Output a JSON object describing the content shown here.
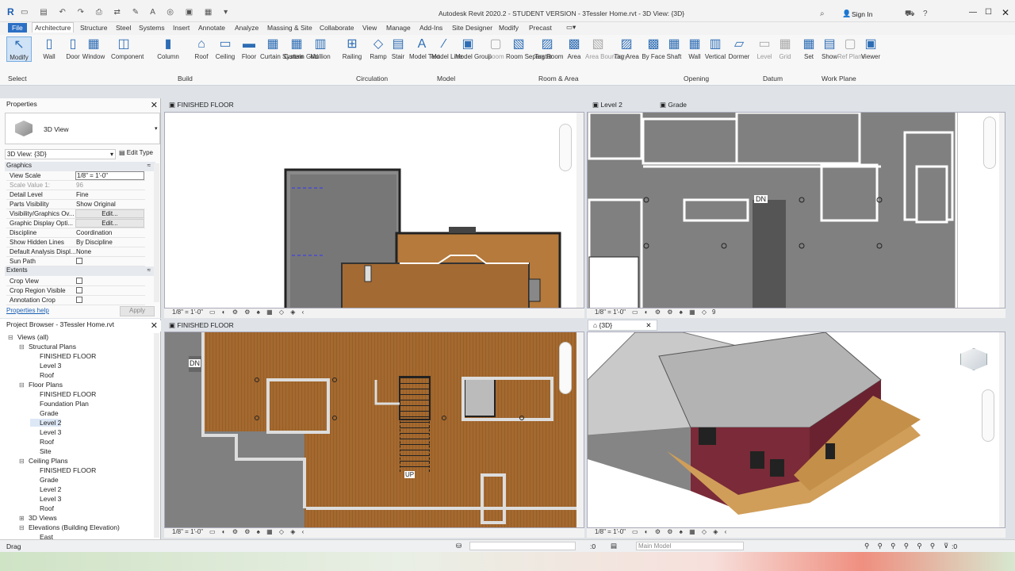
{
  "window": {
    "title": "Autodesk Revit 2020.2 - STUDENT VERSION - 3Tessler Home.rvt - 3D View: {3D}",
    "sign_in": "Sign In"
  },
  "tabs": [
    "File",
    "Architecture",
    "Structure",
    "Steel",
    "Systems",
    "Insert",
    "Annotate",
    "Analyze",
    "Massing & Site",
    "Collaborate",
    "View",
    "Manage",
    "Add-Ins",
    "Site Designer",
    "Modify",
    "Precast"
  ],
  "ribbon": {
    "buttons": [
      {
        "label": "Modify"
      },
      {
        "label": "Wall"
      },
      {
        "label": "Door"
      },
      {
        "label": "Window"
      },
      {
        "label": "Component"
      },
      {
        "label": "Column"
      },
      {
        "label": "Roof"
      },
      {
        "label": "Ceiling"
      },
      {
        "label": "Floor"
      },
      {
        "label": "Curtain System"
      },
      {
        "label": "Curtain Grid"
      },
      {
        "label": "Mullion"
      },
      {
        "label": "Railing"
      },
      {
        "label": "Ramp"
      },
      {
        "label": "Stair"
      },
      {
        "label": "Model Text"
      },
      {
        "label": "Model Line"
      },
      {
        "label": "Model Group"
      },
      {
        "label": "Room"
      },
      {
        "label": "Room Separator"
      },
      {
        "label": "Tag Room"
      },
      {
        "label": "Area"
      },
      {
        "label": "Area Boundary"
      },
      {
        "label": "Tag Area"
      },
      {
        "label": "By Face"
      },
      {
        "label": "Shaft"
      },
      {
        "label": "Wall"
      },
      {
        "label": "Vertical"
      },
      {
        "label": "Dormer"
      },
      {
        "label": "Level"
      },
      {
        "label": "Grid"
      },
      {
        "label": "Set"
      },
      {
        "label": "Show"
      },
      {
        "label": "Ref Plane"
      },
      {
        "label": "Viewer"
      }
    ],
    "groups": [
      "Select",
      "Build",
      "Circulation",
      "Model",
      "Room & Area",
      "Opening",
      "Datum",
      "Work Plane"
    ]
  },
  "properties": {
    "title": "Properties",
    "type_name": "3D View",
    "selector": "3D View: {3D}",
    "edit_type": "Edit Type",
    "cat_graphics": "Graphics",
    "cat_extents": "Extents",
    "rows": [
      {
        "k": "View Scale",
        "v": "1/8\" = 1'-0\""
      },
      {
        "k": "Scale Value    1:",
        "v": "96"
      },
      {
        "k": "Detail Level",
        "v": "Fine"
      },
      {
        "k": "Parts Visibility",
        "v": "Show Original"
      },
      {
        "k": "Visibility/Graphics Ov...",
        "v": "Edit..."
      },
      {
        "k": "Graphic Display Opti...",
        "v": "Edit..."
      },
      {
        "k": "Discipline",
        "v": "Coordination"
      },
      {
        "k": "Show Hidden Lines",
        "v": "By Discipline"
      },
      {
        "k": "Default Analysis Displ...",
        "v": "None"
      },
      {
        "k": "Sun Path",
        "v": ""
      }
    ],
    "extent_rows": [
      {
        "k": "Crop View"
      },
      {
        "k": "Crop Region Visible"
      },
      {
        "k": "Annotation Crop"
      }
    ],
    "help": "Properties help",
    "apply": "Apply"
  },
  "browser": {
    "title": "Project Browser - 3Tessler Home.rvt",
    "items": [
      {
        "label": "Views (all)",
        "lvl": 0,
        "toggle": "⊟"
      },
      {
        "label": "Structural Plans",
        "lvl": 1,
        "toggle": "⊟"
      },
      {
        "label": "FINISHED FLOOR",
        "lvl": 2,
        "toggle": ""
      },
      {
        "label": "Level 3",
        "lvl": 2,
        "toggle": ""
      },
      {
        "label": "Roof",
        "lvl": 2,
        "toggle": ""
      },
      {
        "label": "Floor Plans",
        "lvl": 1,
        "toggle": "⊟"
      },
      {
        "label": "FINISHED FLOOR",
        "lvl": 2,
        "toggle": ""
      },
      {
        "label": "Foundation Plan",
        "lvl": 2,
        "toggle": ""
      },
      {
        "label": "Grade",
        "lvl": 2,
        "toggle": ""
      },
      {
        "label": "Level 2",
        "lvl": 2,
        "toggle": ""
      },
      {
        "label": "Level 3",
        "lvl": 2,
        "toggle": ""
      },
      {
        "label": "Roof",
        "lvl": 2,
        "toggle": ""
      },
      {
        "label": "Site",
        "lvl": 2,
        "toggle": ""
      },
      {
        "label": "Ceiling Plans",
        "lvl": 1,
        "toggle": "⊟"
      },
      {
        "label": "FINISHED FLOOR",
        "lvl": 2,
        "toggle": ""
      },
      {
        "label": "Grade",
        "lvl": 2,
        "toggle": ""
      },
      {
        "label": "Level 2",
        "lvl": 2,
        "toggle": ""
      },
      {
        "label": "Level 3",
        "lvl": 2,
        "toggle": ""
      },
      {
        "label": "Roof",
        "lvl": 2,
        "toggle": ""
      },
      {
        "label": "3D Views",
        "lvl": 1,
        "toggle": "⊞"
      },
      {
        "label": "Elevations (Building Elevation)",
        "lvl": 1,
        "toggle": "⊟"
      },
      {
        "label": "East",
        "lvl": 2,
        "toggle": ""
      }
    ]
  },
  "views": {
    "tl": {
      "tab": "FINISHED FLOOR",
      "scale": "1/8\" = 1'-0\""
    },
    "tr": {
      "tab1": "Level 2",
      "tab2": "Grade",
      "scale": "1/8\" = 1'-0\"",
      "stair_label": "DN",
      "count": "9"
    },
    "bl": {
      "tab": "FINISHED FLOOR",
      "scale": "1/8\" = 1'-0\"",
      "dn": "DN",
      "up": "UP"
    },
    "br": {
      "tab": "{3D}",
      "scale": "1/8\" = 1'-0\""
    }
  },
  "status": {
    "text": "Drag",
    "coord": ":0",
    "model": "Main Model",
    "filter": ":0"
  }
}
